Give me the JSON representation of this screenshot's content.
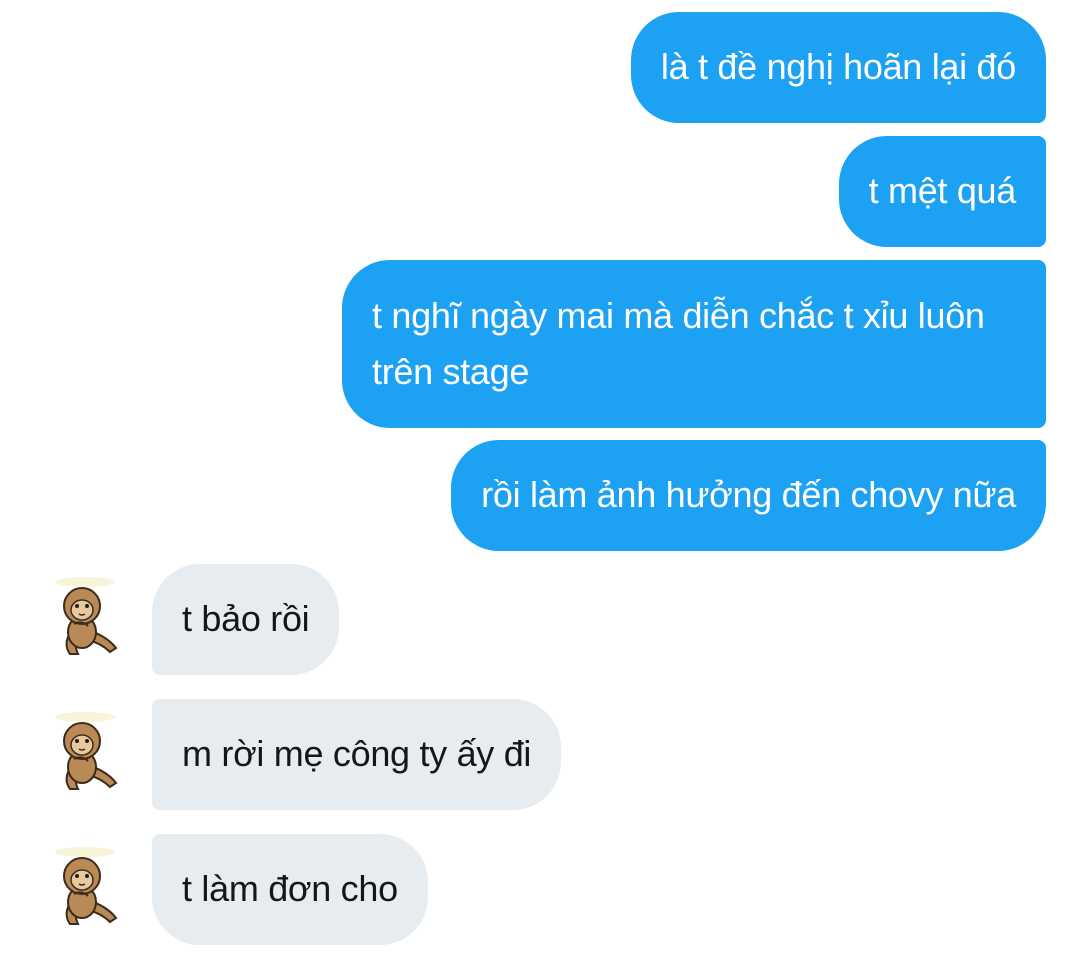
{
  "conversation": {
    "messages": [
      {
        "direction": "outgoing",
        "text": "là t đề nghị hoãn lại đó"
      },
      {
        "direction": "outgoing",
        "text": "t mệt quá"
      },
      {
        "direction": "outgoing",
        "text": "t nghĩ ngày mai mà diễn chắc t xỉu luôn trên stage"
      },
      {
        "direction": "outgoing",
        "text": "rồi làm ảnh hưởng đến chovy nữa"
      },
      {
        "direction": "incoming",
        "text": "t bảo rồi",
        "avatar_icon": "monkey-sticker-avatar"
      },
      {
        "direction": "incoming",
        "text": "m rời mẹ công ty ấy đi",
        "avatar_icon": "monkey-sticker-avatar"
      },
      {
        "direction": "incoming",
        "text": "t làm đơn cho",
        "avatar_icon": "monkey-sticker-avatar"
      }
    ]
  },
  "colors": {
    "outgoing_bubble": "#1da1f2",
    "outgoing_text": "#ffffff",
    "incoming_bubble": "#e6ecf0",
    "incoming_text": "#14171a",
    "background": "#ffffff"
  }
}
